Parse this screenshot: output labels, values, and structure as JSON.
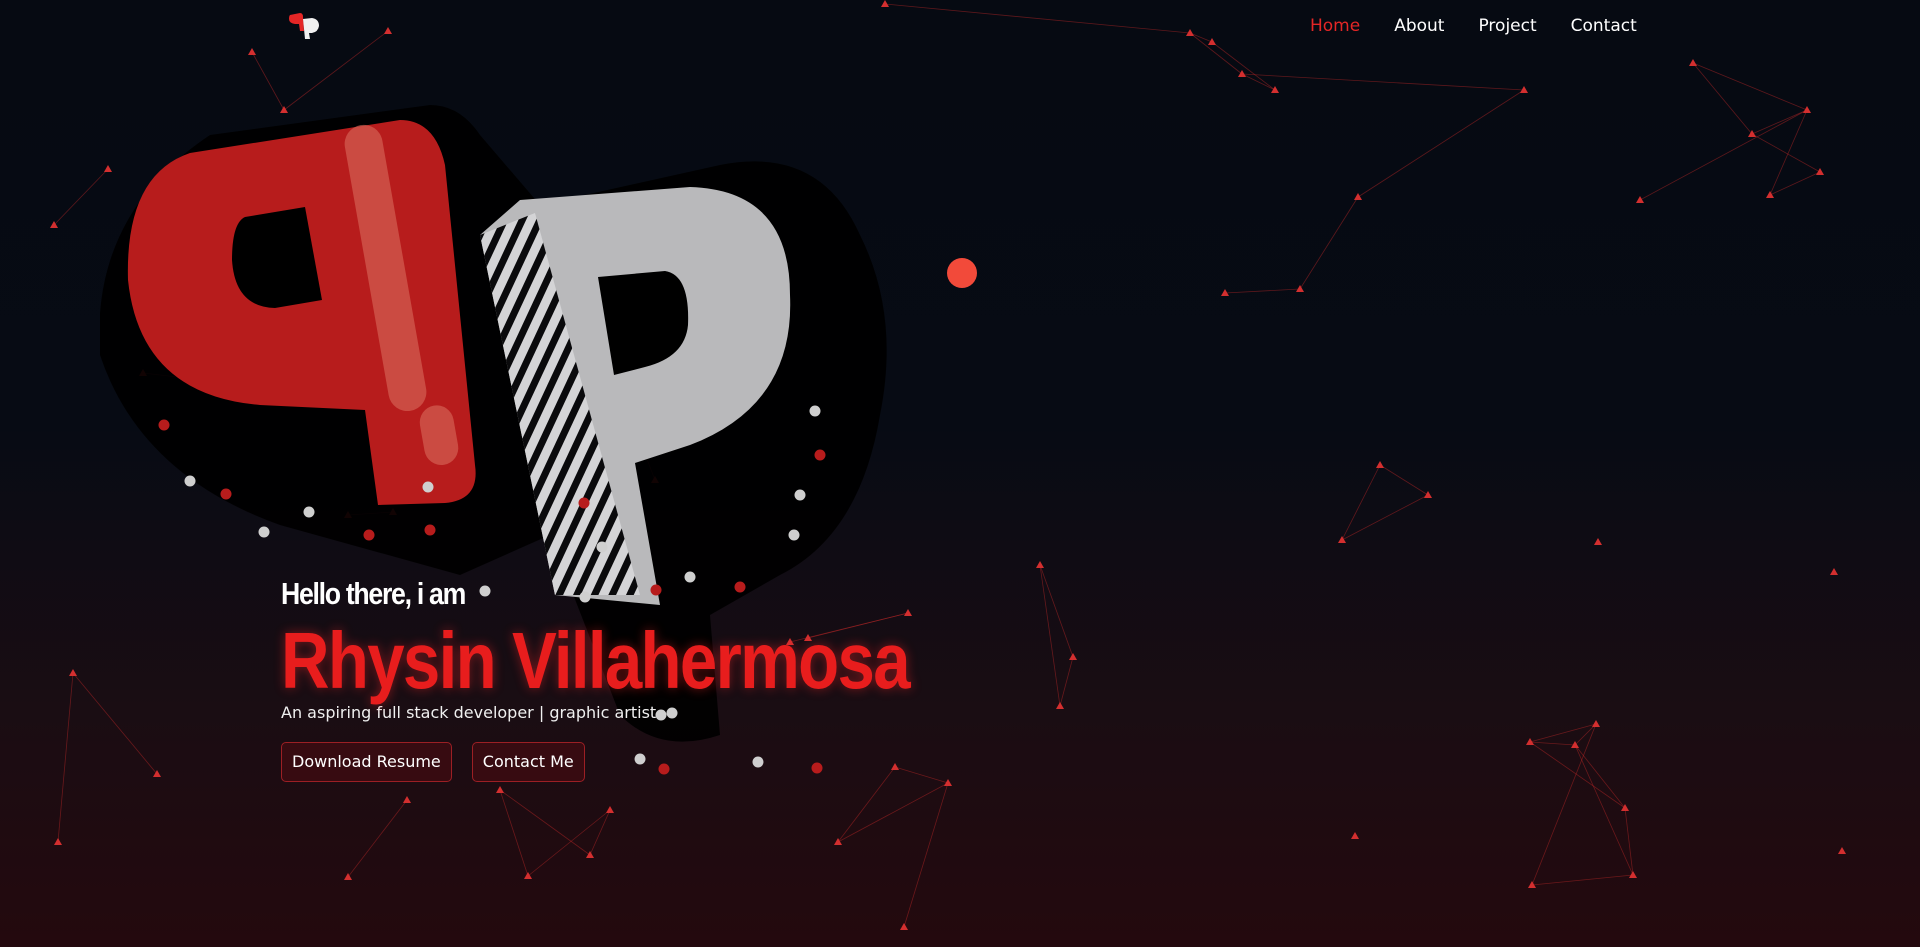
{
  "nav": {
    "logo_alt": "PP",
    "links": [
      "Home",
      "About",
      "Project",
      "Contact"
    ],
    "active": "Home"
  },
  "hero": {
    "greeting": "Hello there, i am",
    "name": "Rhysin Villahermosa",
    "tagline": "An aspiring full stack developer | graphic artist",
    "buttons": {
      "resume": "Download Resume",
      "contact": "Contact Me"
    }
  },
  "colors": {
    "accent": "#e42626",
    "background_top": "#060a12",
    "background_bottom": "#24090e",
    "logo_grey": "#b9b9bb",
    "logo_red": "#b71c1c"
  }
}
